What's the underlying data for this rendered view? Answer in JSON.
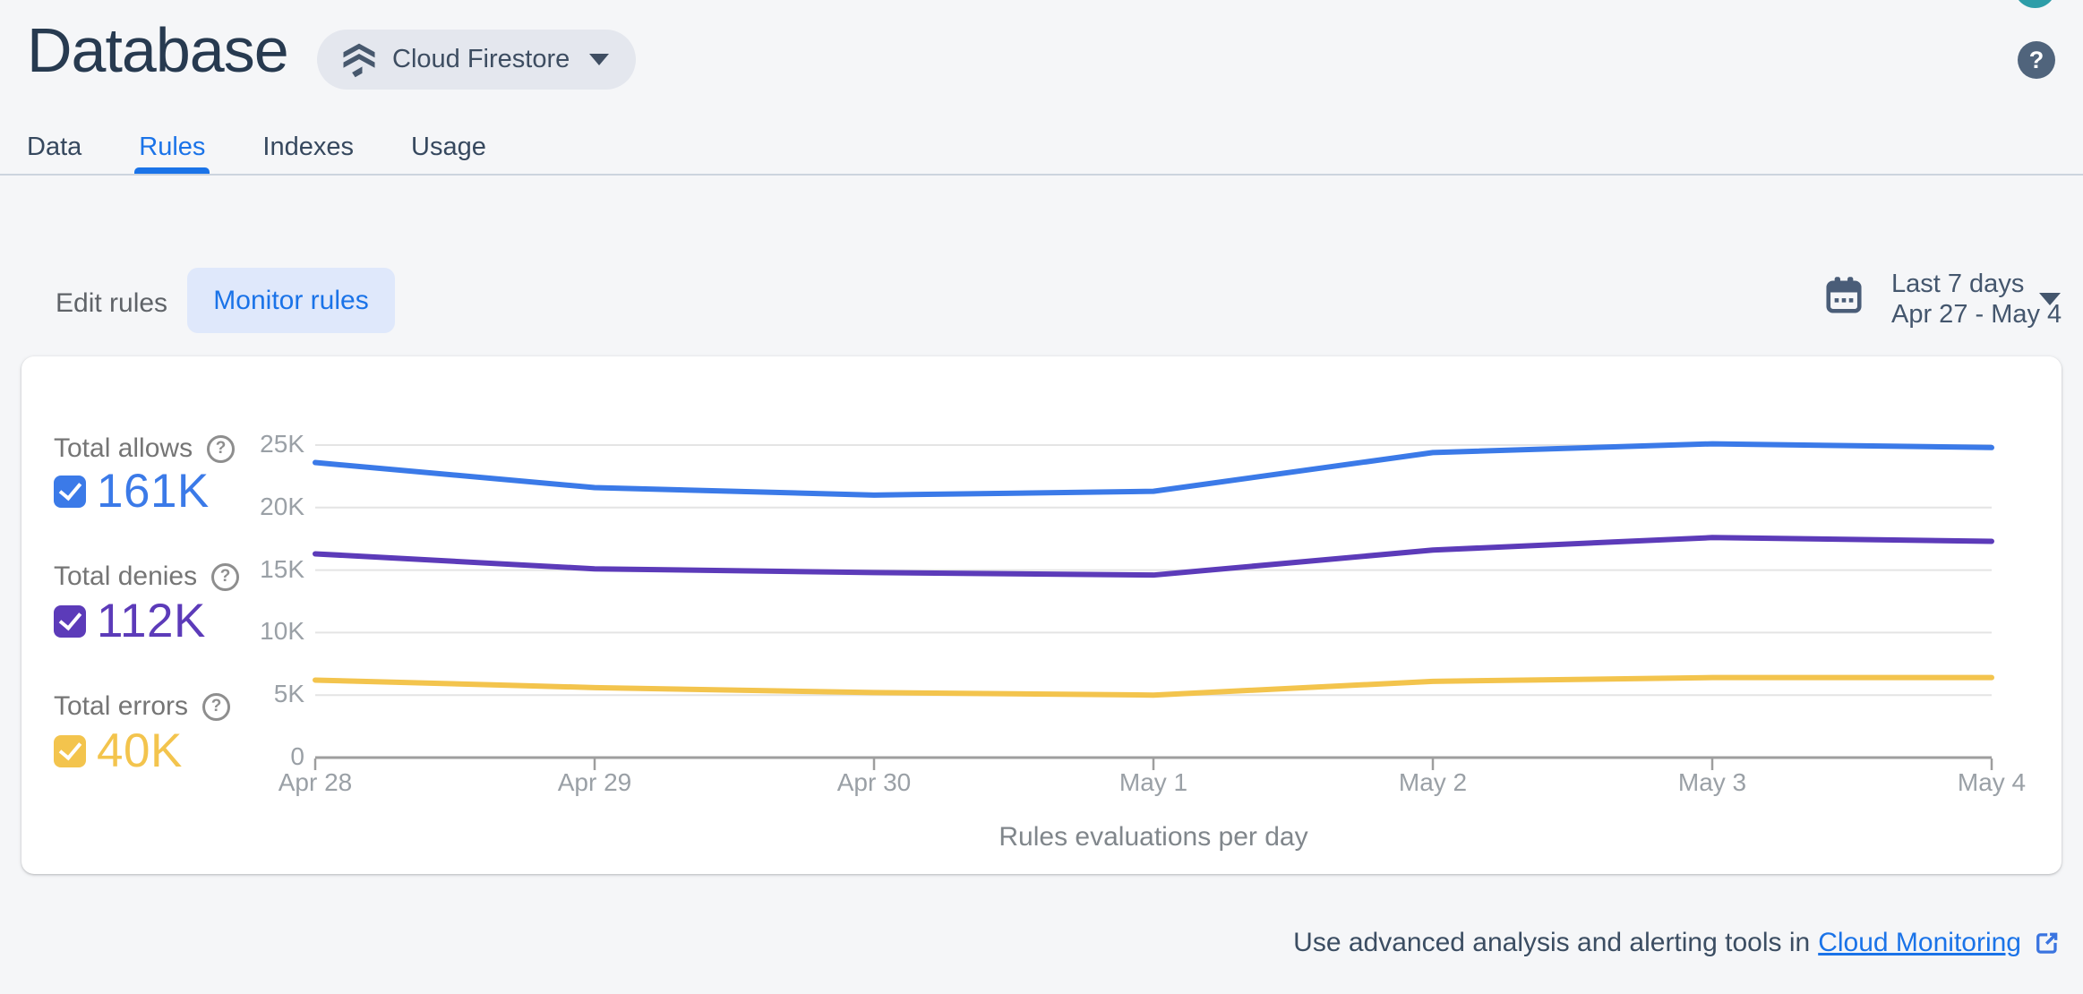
{
  "header": {
    "title": "Database",
    "product_selector": {
      "label": "Cloud Firestore",
      "icon": "firestore-icon"
    },
    "avatar_color": "#2d9da8",
    "help_icon": "question-mark-icon"
  },
  "tabs": [
    {
      "label": "Data",
      "active": false
    },
    {
      "label": "Rules",
      "active": true
    },
    {
      "label": "Indexes",
      "active": false
    },
    {
      "label": "Usage",
      "active": false
    }
  ],
  "rules_toolbar": {
    "edit_rules_label": "Edit rules",
    "monitor_rules_label": "Monitor rules",
    "date_range": {
      "icon": "calendar-icon",
      "primary": "Last 7 days",
      "secondary": "Apr 27 - May 4"
    }
  },
  "legend": [
    {
      "label": "Total allows",
      "value": "161K",
      "color": "#3b7ae8",
      "checked": true
    },
    {
      "label": "Total denies",
      "value": "112K",
      "color": "#5c3bb9",
      "checked": true
    },
    {
      "label": "Total errors",
      "value": "40K",
      "color": "#f3c44d",
      "checked": true
    }
  ],
  "chart_data": {
    "type": "line",
    "caption": "Rules evaluations per day",
    "categories": [
      "Apr 28",
      "Apr 29",
      "Apr 30",
      "May 1",
      "May 2",
      "May 3",
      "May 4"
    ],
    "series": [
      {
        "name": "Total allows",
        "color": "#3b7ae8",
        "values": [
          23600,
          21600,
          21000,
          21300,
          24400,
          25100,
          24800
        ]
      },
      {
        "name": "Total denies",
        "color": "#5c3bb9",
        "values": [
          16300,
          15100,
          14800,
          14600,
          16600,
          17600,
          17300
        ]
      },
      {
        "name": "Total errors",
        "color": "#f3c44d",
        "values": [
          6200,
          5600,
          5200,
          5000,
          6100,
          6400,
          6400
        ]
      }
    ],
    "y_ticks": [
      {
        "label": "25K",
        "value": 25000
      },
      {
        "label": "20K",
        "value": 20000
      },
      {
        "label": "15K",
        "value": 15000
      },
      {
        "label": "10K",
        "value": 10000
      },
      {
        "label": "5K",
        "value": 5000
      },
      {
        "label": "0",
        "value": 0
      }
    ],
    "ylim": [
      0,
      25000
    ],
    "grid": true,
    "legend_position": "left"
  },
  "footer": {
    "text": "Use advanced analysis and alerting tools in",
    "link_label": "Cloud Monitoring"
  }
}
